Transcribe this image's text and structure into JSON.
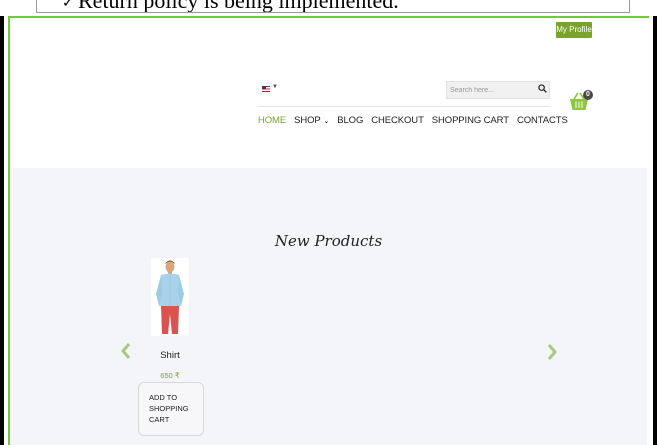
{
  "caption": {
    "bullet": "✓",
    "text": "Return policy is being implemented."
  },
  "header": {
    "my_profile_label": "My Profile",
    "language_flag": "us-flag-icon",
    "search": {
      "placeholder": "Search here...",
      "value": ""
    },
    "cart": {
      "count": "0",
      "icon": "basket-icon"
    },
    "nav": [
      {
        "label": "HOME",
        "active": true
      },
      {
        "label": "SHOP",
        "has_dropdown": true
      },
      {
        "label": "BLOG"
      },
      {
        "label": "CHECKOUT"
      },
      {
        "label": "SHOPPING CART"
      },
      {
        "label": "CONTACTS"
      }
    ]
  },
  "main": {
    "section_title": "New Products",
    "products": [
      {
        "name": "Shirt",
        "price": "650 ₹",
        "button_label": "ADD TO SHOPPING CART"
      }
    ]
  },
  "colors": {
    "accent": "#7aa32b",
    "content_background": "#f4f5f8",
    "frame_border": "#6ecb3a"
  }
}
